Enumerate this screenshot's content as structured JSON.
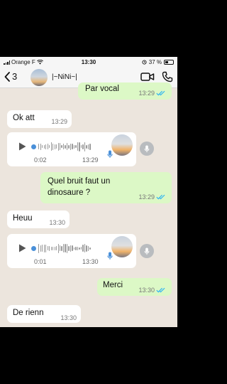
{
  "status_bar": {
    "carrier": "Orange F",
    "time": "13:30",
    "battery": "37 %",
    "battery_level": 0.37
  },
  "header": {
    "back_count": "3",
    "contact_name": "|~NiNi~|"
  },
  "messages": [
    {
      "type": "text",
      "direction": "out",
      "text": "Par vocal",
      "time": "13:29",
      "read": true
    },
    {
      "type": "text",
      "direction": "in",
      "text": "Ok att",
      "time": "13:29"
    },
    {
      "type": "voice",
      "direction": "in",
      "duration": "0:02",
      "time": "13:29"
    },
    {
      "type": "text",
      "direction": "out",
      "text": "Quel bruit faut un dinosaure ?",
      "time": "13:29",
      "read": true
    },
    {
      "type": "text",
      "direction": "in",
      "text": "Heuu",
      "time": "13:30"
    },
    {
      "type": "voice",
      "direction": "in",
      "duration": "0:01",
      "time": "13:30"
    },
    {
      "type": "text",
      "direction": "out",
      "text": "Merci",
      "time": "13:30",
      "read": true
    },
    {
      "type": "text",
      "direction": "in",
      "text": "De rienn",
      "time": "13:30"
    }
  ],
  "colors": {
    "outgoing": "#dcf8c6",
    "incoming": "#ffffff",
    "read_ticks": "#34b7f1",
    "background": "#ece5dd",
    "header_icons": "#111111"
  }
}
